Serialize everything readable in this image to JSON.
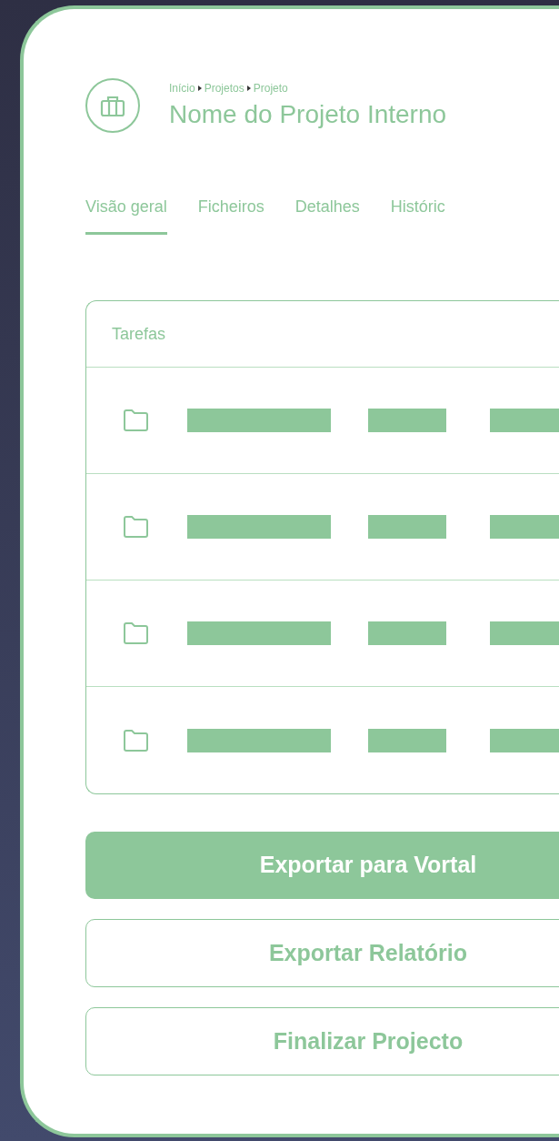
{
  "header": {
    "breadcrumb": [
      "Início",
      "Projetos",
      "Projeto"
    ],
    "title": "Nome do Projeto Interno"
  },
  "tabs": [
    {
      "label": "Visão geral",
      "selected": true
    },
    {
      "label": "Ficheiros",
      "selected": false
    },
    {
      "label": "Detalhes",
      "selected": false
    },
    {
      "label": "Históric",
      "selected": false
    }
  ],
  "tasks": {
    "title": "Tarefas",
    "rows": [
      {
        "kind": "folder"
      },
      {
        "kind": "folder"
      },
      {
        "kind": "folder"
      },
      {
        "kind": "folder"
      }
    ]
  },
  "actions": [
    {
      "label": "Exportar para Vortal",
      "kind": "primary"
    },
    {
      "label": "Exportar Relatório",
      "kind": "secondary"
    },
    {
      "label": "Finalizar Projecto",
      "kind": "secondary"
    }
  ]
}
